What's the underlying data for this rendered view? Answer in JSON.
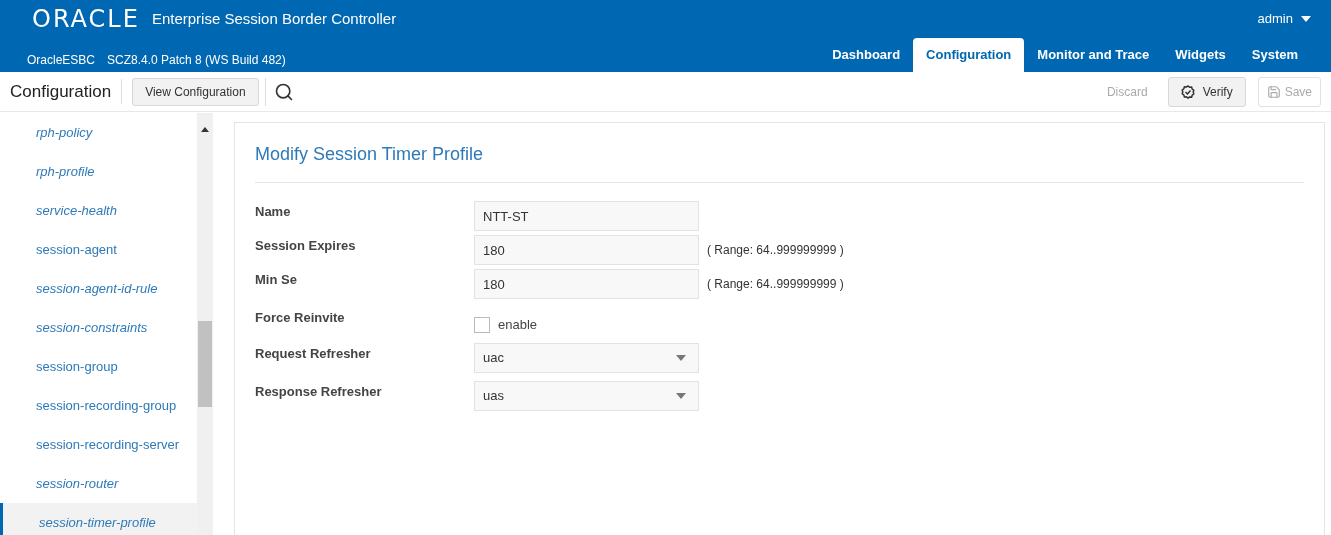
{
  "header": {
    "logo": "ORACLE",
    "product": "Enterprise Session Border Controller",
    "user": "admin",
    "system_name": "OracleESBC",
    "version": "SCZ8.4.0 Patch 8 (WS Build 482)"
  },
  "tabs": [
    {
      "label": "Dashboard",
      "selected": false
    },
    {
      "label": "Configuration",
      "selected": true
    },
    {
      "label": "Monitor and Trace",
      "selected": false
    },
    {
      "label": "Widgets",
      "selected": false
    },
    {
      "label": "System",
      "selected": false
    }
  ],
  "toolbar": {
    "title": "Configuration",
    "view_button": "View Configuration",
    "discard": {
      "label": "Discard",
      "disabled": true
    },
    "verify": {
      "label": "Verify",
      "disabled": false
    },
    "save": {
      "label": "Save",
      "disabled": true
    }
  },
  "sidebar": {
    "items": [
      {
        "label": "rph-policy",
        "italic": true,
        "selected": false
      },
      {
        "label": "rph-profile",
        "italic": true,
        "selected": false
      },
      {
        "label": "service-health",
        "italic": true,
        "selected": false
      },
      {
        "label": "session-agent",
        "italic": false,
        "selected": false
      },
      {
        "label": "session-agent-id-rule",
        "italic": true,
        "selected": false
      },
      {
        "label": "session-constraints",
        "italic": true,
        "selected": false
      },
      {
        "label": "session-group",
        "italic": false,
        "selected": false
      },
      {
        "label": "session-recording-group",
        "italic": false,
        "selected": false
      },
      {
        "label": "session-recording-server",
        "italic": false,
        "selected": false
      },
      {
        "label": "session-router",
        "italic": true,
        "selected": false
      },
      {
        "label": "session-timer-profile",
        "italic": true,
        "selected": true
      }
    ]
  },
  "form": {
    "title": "Modify Session Timer Profile",
    "fields": [
      {
        "kind": "text",
        "label": "Name",
        "value": "NTT-ST"
      },
      {
        "kind": "text",
        "label": "Session Expires",
        "value": "180",
        "hint": "( Range: 64..999999999 )"
      },
      {
        "kind": "text",
        "label": "Min Se",
        "value": "180",
        "hint": "( Range: 64..999999999 )"
      },
      {
        "kind": "checkbox",
        "label": "Force Reinvite",
        "option": "enable",
        "checked": false
      },
      {
        "kind": "select",
        "label": "Request Refresher",
        "value": "uac"
      },
      {
        "kind": "select",
        "label": "Response Refresher",
        "value": "uas"
      }
    ]
  }
}
